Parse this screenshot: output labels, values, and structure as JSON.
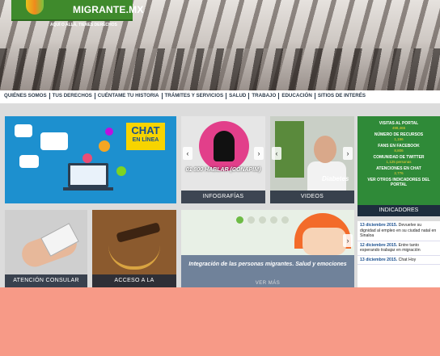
{
  "header": {
    "logo_text": "MIGRANTE.MX",
    "tagline": "AQUÍ O ALLÁ, TIENES DERECHOS"
  },
  "nav": {
    "items": [
      "QUIÉNES SOMOS",
      "TUS DERECHOS",
      "CUÉNTAME TU HISTORIA",
      "TRÁMITES Y SERVICIOS",
      "SALUD",
      "TRABAJO",
      "EDUCACIÓN",
      "SITIOS DE INTERÉS"
    ]
  },
  "tiles": {
    "chat": {
      "title": "CHAT",
      "subtitle": "EN LÍNEA"
    },
    "infografias": {
      "caption": "01 800 HABLAR (CONAPIM)",
      "label": "INFOGRAFÍAS"
    },
    "videos": {
      "overlay": "Diabetes",
      "label": "VIDEOS"
    },
    "consular": {
      "label": "ATENCIÓN CONSULAR"
    },
    "justicia": {
      "label": "ACCESO A LA"
    },
    "integracion": {
      "text": "Integración de las personas migrantes. Salud y emociones",
      "sub": "VER MÁS"
    }
  },
  "indicators": {
    "rows": [
      {
        "label": "VISITAS AL PORTAL",
        "value": "498,465"
      },
      {
        "label": "NÚMERO DE RECURSOS",
        "value": "1,196"
      },
      {
        "label": "FANS EN FACEBOOK",
        "value": "8,806"
      },
      {
        "label": "COMUNIDAD DE TWITTER",
        "value": "1,125 personas"
      },
      {
        "label": "ATENCIONES EN CHAT",
        "value": "2,776"
      },
      {
        "label": "VER OTROS INDICADORES DEL PORTAL",
        "value": ""
      }
    ],
    "label": "INDICADORES"
  },
  "news": [
    {
      "date": "13 diciembre 2015.",
      "text": "Devuelve su dignidad al empleo en su ciudad natal en Sinaloa"
    },
    {
      "date": "12 diciembre 2015.",
      "text": "Entre tanto esperando trabajar en migración"
    },
    {
      "date": "13 diciembre 2015.",
      "text": "Chat Hoy"
    }
  ]
}
